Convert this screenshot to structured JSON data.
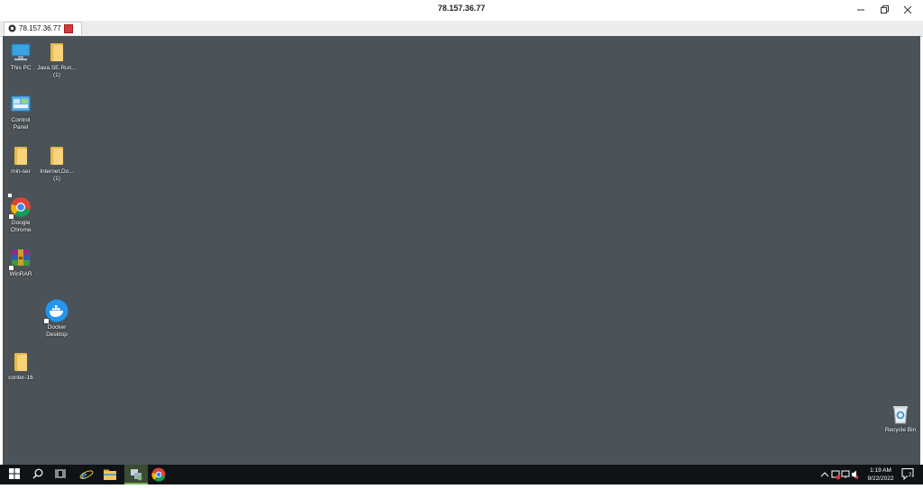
{
  "window": {
    "title": "78.157.36.77",
    "tab_label": "78.157.36.77"
  },
  "desktop": {
    "icons": [
      {
        "label": "This PC",
        "icon": "computer-icon"
      },
      {
        "label": "Java.SE.Run...",
        "sublabel": "(1)",
        "icon": "folder-icon"
      },
      {
        "label": "Control",
        "sublabel": "Panel",
        "icon": "control-panel-icon"
      },
      {
        "label": "min-ser",
        "icon": "folder-icon"
      },
      {
        "label": "Internet.Do...",
        "sublabel": "(1)",
        "icon": "folder-icon"
      },
      {
        "label": "Google",
        "sublabel": "Chrome",
        "icon": "chrome-icon"
      },
      {
        "label": "WinRAR",
        "icon": "winrar-icon"
      },
      {
        "label": "Docker",
        "sublabel": "Desktop",
        "icon": "docker-icon"
      },
      {
        "label": "conter-16",
        "icon": "folder-icon"
      },
      {
        "label": "Recycle Bin",
        "icon": "recycle-bin-icon"
      }
    ]
  },
  "taskbar": {
    "clock_time": "1:19 AM",
    "clock_date": "9/22/2022",
    "notification_count": "2"
  },
  "colors": {
    "desktop_bg": "#4b5359",
    "taskbar_bg": "#101316",
    "folder": "#f3c55b"
  }
}
